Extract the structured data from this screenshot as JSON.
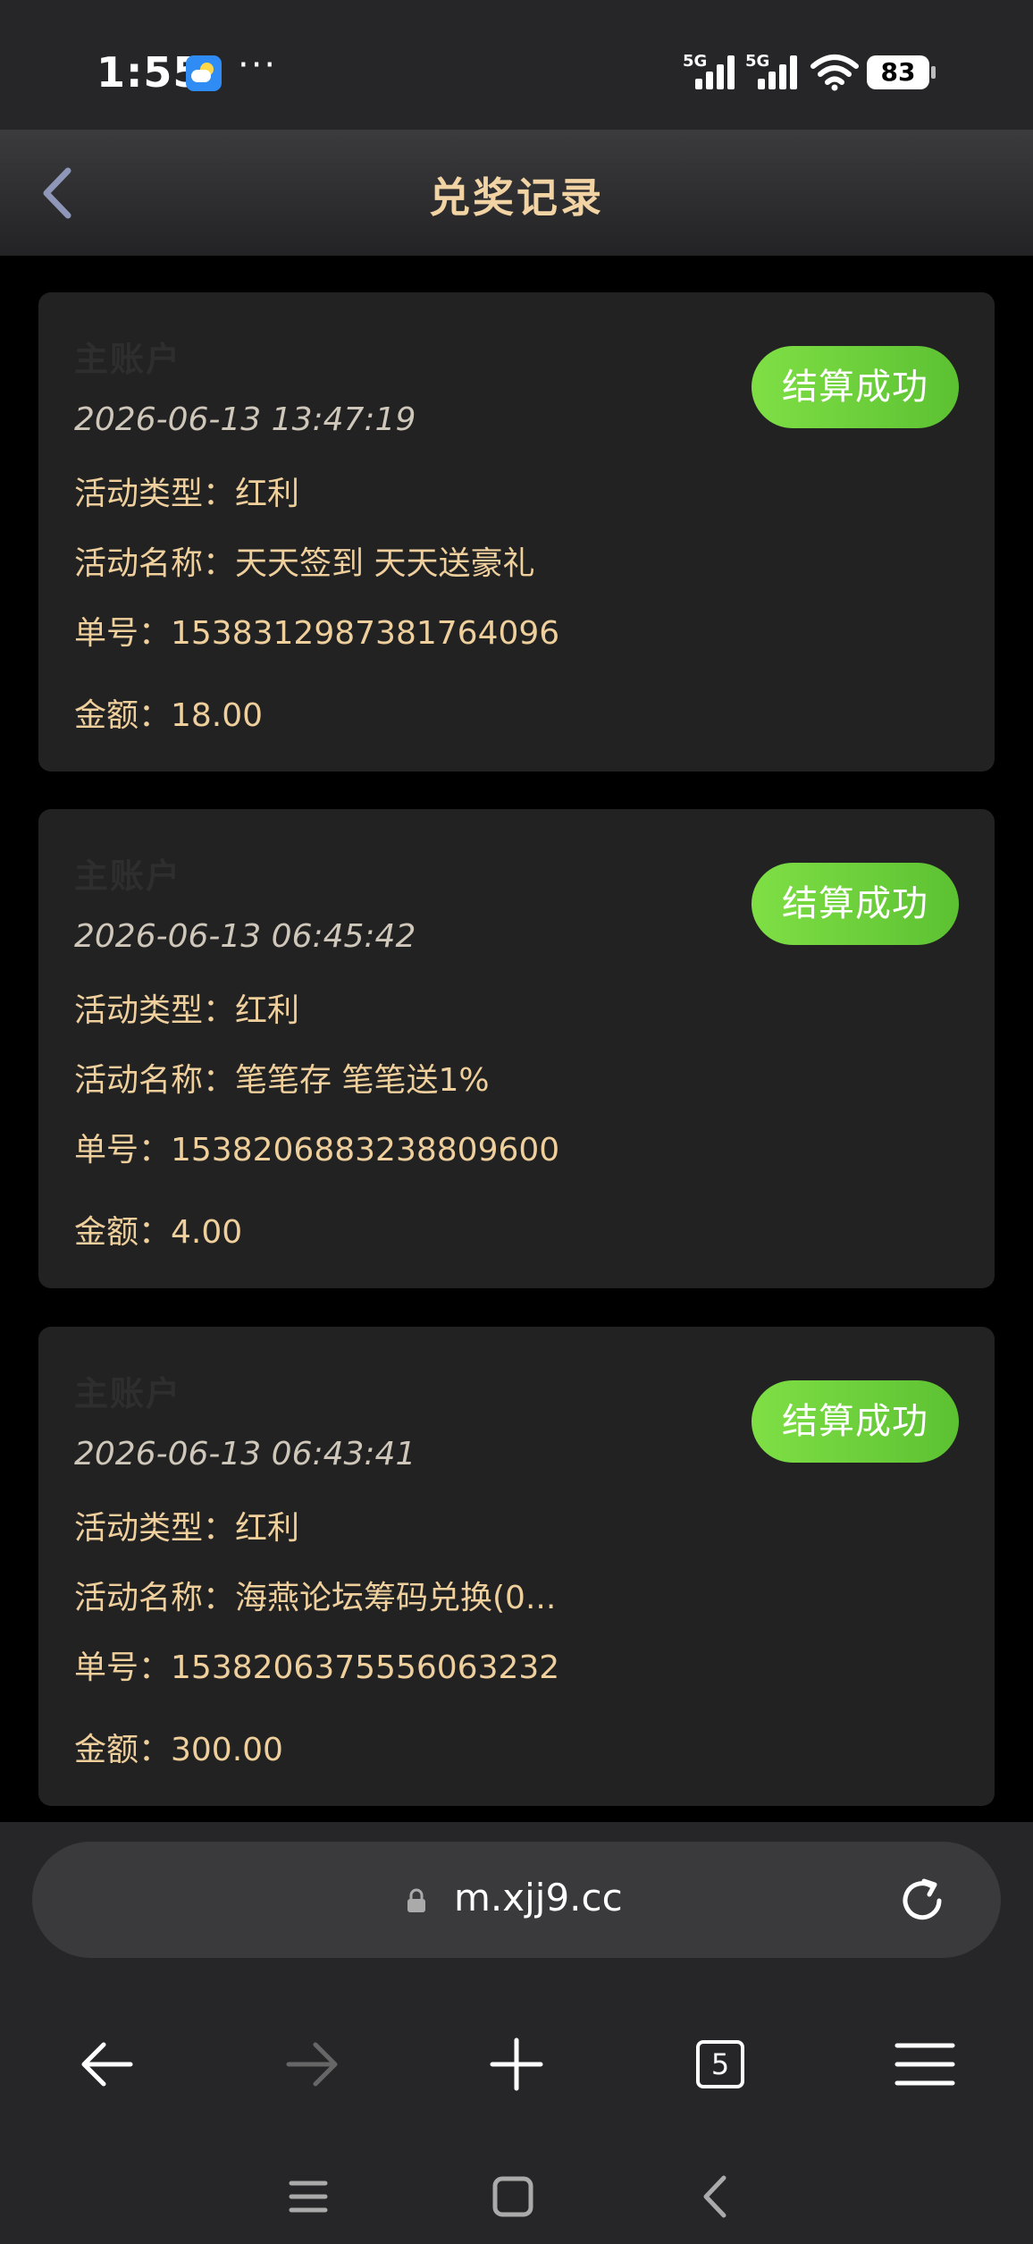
{
  "status_bar": {
    "time": "1:55",
    "signal1_label": "5G",
    "signal2_label": "5G",
    "battery": "83",
    "icons": [
      "weather-icon",
      "more-dots-icon",
      "signal-icon",
      "wifi-icon",
      "battery-icon"
    ]
  },
  "header": {
    "title": "兑奖记录",
    "back_icon": "chevron-left-icon"
  },
  "records": [
    {
      "account": "主账户",
      "datetime": "2026-06-13 13:47:19",
      "type": "活动类型：红利",
      "name": "活动名称：天天签到 天天送豪礼",
      "order": "单号：1538312987381764096",
      "amount": "金额：18.00",
      "status": "结算成功"
    },
    {
      "account": "主账户",
      "datetime": "2026-06-13 06:45:42",
      "type": "活动类型：红利",
      "name": "活动名称：笔笔存 笔笔送1%",
      "order": "单号：1538206883238809600",
      "amount": "金额：4.00",
      "status": "结算成功"
    },
    {
      "account": "主账户",
      "datetime": "2026-06-13 06:43:41",
      "type": "活动类型：红利",
      "name": "活动名称：海燕论坛筹码兑换(0...",
      "order": "单号：1538206375556063232",
      "amount": "金额：300.00",
      "status": "结算成功"
    }
  ],
  "browser": {
    "url": "m.xjj9.cc",
    "tab_count": "5",
    "icons": [
      "lock-icon",
      "reload-icon",
      "back-arrow-icon",
      "forward-arrow-icon",
      "new-tab-icon",
      "tabs-icon",
      "menu-icon"
    ]
  },
  "colors": {
    "accent_gold": "#f1d3a4",
    "status_green": "#6fd03c",
    "card_bg": "#222223"
  }
}
